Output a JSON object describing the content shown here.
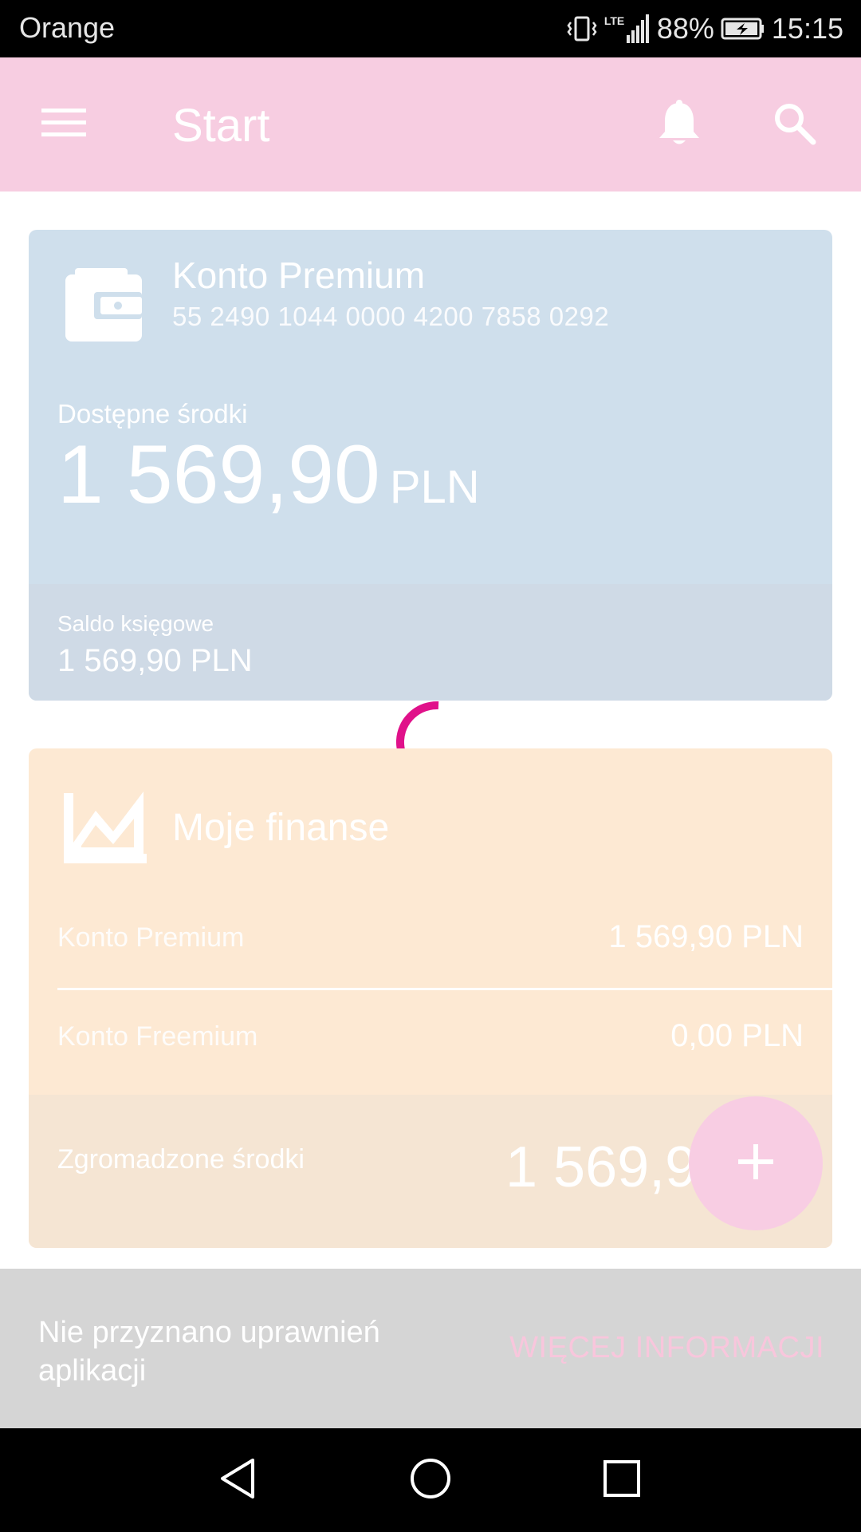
{
  "status_bar": {
    "carrier": "Orange",
    "network": "LTE",
    "battery": "88%",
    "time": "15:15",
    "icons": [
      "vibrate-icon",
      "lte-icon",
      "signal-icon",
      "battery-charging-icon"
    ]
  },
  "app_bar": {
    "title": "Start",
    "icons": [
      "menu-icon",
      "bell-icon",
      "search-icon"
    ]
  },
  "account": {
    "name": "Konto Premium",
    "number": "55 2490 1044 0000 4200 7858 0292",
    "available_label": "Dostępne środki",
    "available_amount": "1 569,90",
    "available_currency": "PLN",
    "balance_label": "Saldo księgowe",
    "balance_value": "1 569,90 PLN",
    "icon": "wallet-icon"
  },
  "finances": {
    "title": "Moje finanse",
    "icon": "chart-icon",
    "rows": [
      {
        "label": "Konto Premium",
        "value": "1 569,90 PLN"
      },
      {
        "label": "Konto Freemium",
        "value": "0,00 PLN"
      }
    ],
    "total_label": "Zgromadzone środki",
    "total_value": "1 569,9"
  },
  "fab": {
    "icon": "plus-icon",
    "label": "+"
  },
  "snackbar": {
    "message": "Nie przyznano uprawnień aplikacji",
    "action": "WIĘCEJ INFORMACJI"
  },
  "nav_bar": {
    "icons": [
      "back-icon",
      "home-icon",
      "recents-icon"
    ]
  },
  "colors": {
    "app_bar": "#f7cde1",
    "account_card": "#cfdfec",
    "finance_card": "#fde9d3",
    "spinner": "#e0118a",
    "snackbar": "#d5d5d5",
    "snackbar_action": "#f8c6dc",
    "fab": "#f8cde3"
  }
}
